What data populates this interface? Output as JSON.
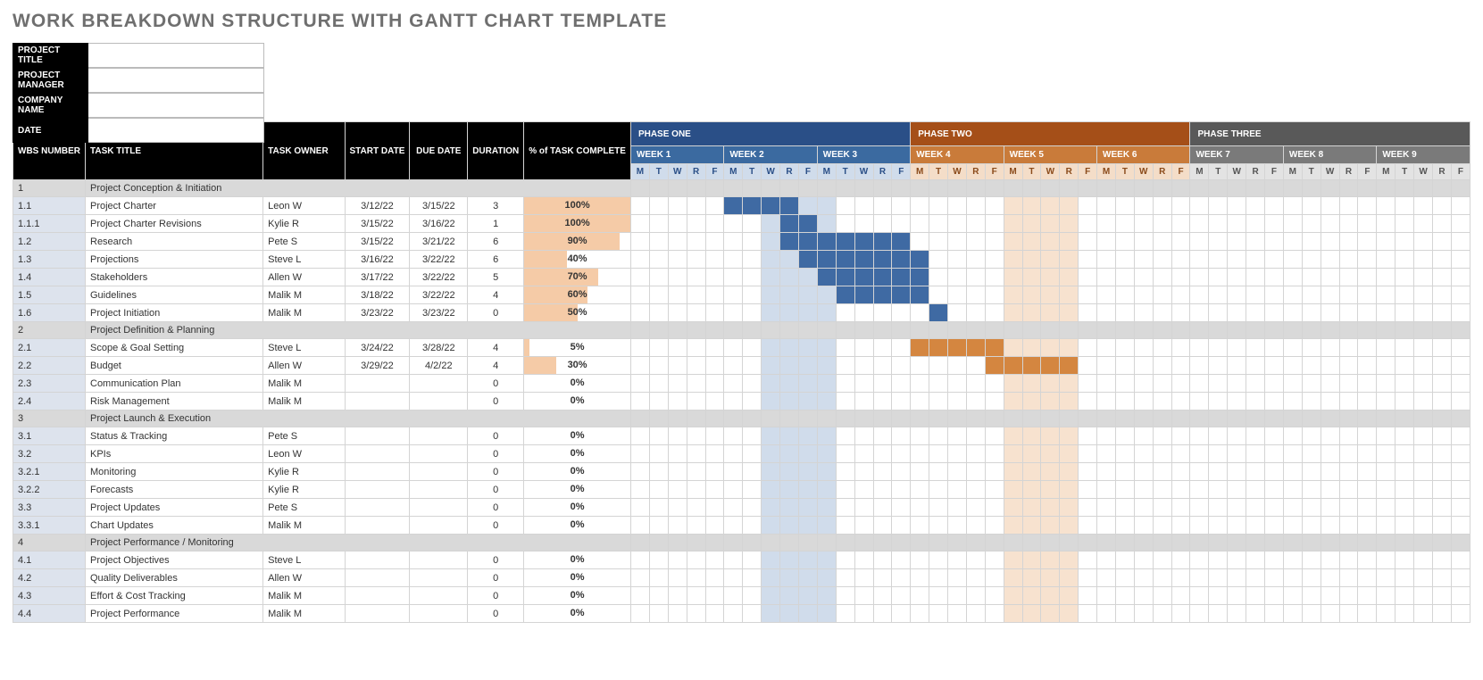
{
  "title": "WORK BREAKDOWN STRUCTURE WITH GANTT CHART TEMPLATE",
  "meta_labels": {
    "project_title": "PROJECT TITLE",
    "project_manager": "PROJECT MANAGER",
    "company_name": "COMPANY NAME",
    "date": "DATE"
  },
  "headers": {
    "wbs": "WBS NUMBER",
    "task_title": "TASK TITLE",
    "task_owner": "TASK OWNER",
    "start_date": "START DATE",
    "due_date": "DUE DATE",
    "duration": "DURATION",
    "pct": "% of TASK COMPLETE"
  },
  "phases": [
    {
      "label": "PHASE ONE",
      "weeks": 3,
      "color": "blue"
    },
    {
      "label": "PHASE TWO",
      "weeks": 3,
      "color": "orange"
    },
    {
      "label": "PHASE THREE",
      "weeks": 3,
      "color": "gray"
    }
  ],
  "week_labels": [
    "WEEK 1",
    "WEEK 2",
    "WEEK 3",
    "WEEK 4",
    "WEEK 5",
    "WEEK 6",
    "WEEK 7",
    "WEEK 8",
    "WEEK 9"
  ],
  "day_labels": [
    "M",
    "T",
    "W",
    "R",
    "F"
  ],
  "blue_light_cols": [
    7,
    8,
    9,
    10
  ],
  "orange_light_cols": [
    20,
    21,
    22,
    23
  ],
  "rows": [
    {
      "type": "section",
      "wbs": "1",
      "title": "Project Conception & Initiation"
    },
    {
      "type": "task",
      "wbs": "1.1",
      "title": "Project Charter",
      "owner": "Leon W",
      "start": "3/12/22",
      "due": "3/15/22",
      "dur": "3",
      "pct": 100,
      "bar": {
        "color": "blue",
        "start": 5,
        "len": 4
      }
    },
    {
      "type": "task",
      "wbs": "1.1.1",
      "title": "Project Charter Revisions",
      "owner": "Kylie R",
      "start": "3/15/22",
      "due": "3/16/22",
      "dur": "1",
      "pct": 100,
      "bar": {
        "color": "blue",
        "start": 8,
        "len": 2
      }
    },
    {
      "type": "task",
      "wbs": "1.2",
      "title": "Research",
      "owner": "Pete S",
      "start": "3/15/22",
      "due": "3/21/22",
      "dur": "6",
      "pct": 90,
      "bar": {
        "color": "blue",
        "start": 8,
        "len": 7
      }
    },
    {
      "type": "task",
      "wbs": "1.3",
      "title": "Projections",
      "owner": "Steve L",
      "start": "3/16/22",
      "due": "3/22/22",
      "dur": "6",
      "pct": 40,
      "bar": {
        "color": "blue",
        "start": 9,
        "len": 7
      }
    },
    {
      "type": "task",
      "wbs": "1.4",
      "title": "Stakeholders",
      "owner": "Allen W",
      "start": "3/17/22",
      "due": "3/22/22",
      "dur": "5",
      "pct": 70,
      "bar": {
        "color": "blue",
        "start": 10,
        "len": 6
      }
    },
    {
      "type": "task",
      "wbs": "1.5",
      "title": "Guidelines",
      "owner": "Malik M",
      "start": "3/18/22",
      "due": "3/22/22",
      "dur": "4",
      "pct": 60,
      "bar": {
        "color": "blue",
        "start": 11,
        "len": 5
      }
    },
    {
      "type": "task",
      "wbs": "1.6",
      "title": "Project Initiation",
      "owner": "Malik M",
      "start": "3/23/22",
      "due": "3/23/22",
      "dur": "0",
      "pct": 50,
      "bar": {
        "color": "blue",
        "start": 16,
        "len": 1
      }
    },
    {
      "type": "section",
      "wbs": "2",
      "title": "Project Definition & Planning"
    },
    {
      "type": "task",
      "wbs": "2.1",
      "title": "Scope & Goal Setting",
      "owner": "Steve L",
      "start": "3/24/22",
      "due": "3/28/22",
      "dur": "4",
      "pct": 5,
      "bar": {
        "color": "orange",
        "start": 15,
        "len": 5
      }
    },
    {
      "type": "task",
      "wbs": "2.2",
      "title": "Budget",
      "owner": "Allen W",
      "start": "3/29/22",
      "due": "4/2/22",
      "dur": "4",
      "pct": 30,
      "bar": {
        "color": "orange",
        "start": 19,
        "len": 5
      }
    },
    {
      "type": "task",
      "wbs": "2.3",
      "title": "Communication Plan",
      "owner": "Malik M",
      "start": "",
      "due": "",
      "dur": "0",
      "pct": 0
    },
    {
      "type": "task",
      "wbs": "2.4",
      "title": "Risk Management",
      "owner": "Malik M",
      "start": "",
      "due": "",
      "dur": "0",
      "pct": 0
    },
    {
      "type": "section",
      "wbs": "3",
      "title": "Project Launch & Execution"
    },
    {
      "type": "task",
      "wbs": "3.1",
      "title": "Status & Tracking",
      "owner": "Pete S",
      "start": "",
      "due": "",
      "dur": "0",
      "pct": 0
    },
    {
      "type": "task",
      "wbs": "3.2",
      "title": "KPIs",
      "owner": "Leon W",
      "start": "",
      "due": "",
      "dur": "0",
      "pct": 0
    },
    {
      "type": "task",
      "wbs": "3.2.1",
      "title": "Monitoring",
      "owner": "Kylie R",
      "start": "",
      "due": "",
      "dur": "0",
      "pct": 0
    },
    {
      "type": "task",
      "wbs": "3.2.2",
      "title": "Forecasts",
      "owner": "Kylie R",
      "start": "",
      "due": "",
      "dur": "0",
      "pct": 0
    },
    {
      "type": "task",
      "wbs": "3.3",
      "title": "Project Updates",
      "owner": "Pete S",
      "start": "",
      "due": "",
      "dur": "0",
      "pct": 0
    },
    {
      "type": "task",
      "wbs": "3.3.1",
      "title": "Chart Updates",
      "owner": "Malik M",
      "start": "",
      "due": "",
      "dur": "0",
      "pct": 0
    },
    {
      "type": "section",
      "wbs": "4",
      "title": "Project Performance / Monitoring"
    },
    {
      "type": "task",
      "wbs": "4.1",
      "title": "Project Objectives",
      "owner": "Steve L",
      "start": "",
      "due": "",
      "dur": "0",
      "pct": 0
    },
    {
      "type": "task",
      "wbs": "4.2",
      "title": "Quality Deliverables",
      "owner": "Allen W",
      "start": "",
      "due": "",
      "dur": "0",
      "pct": 0
    },
    {
      "type": "task",
      "wbs": "4.3",
      "title": "Effort & Cost Tracking",
      "owner": "Malik M",
      "start": "",
      "due": "",
      "dur": "0",
      "pct": 0
    },
    {
      "type": "task",
      "wbs": "4.4",
      "title": "Project Performance",
      "owner": "Malik M",
      "start": "",
      "due": "",
      "dur": "0",
      "pct": 0
    }
  ],
  "chart_data": {
    "type": "table",
    "title": "Work Breakdown Structure with Gantt Chart",
    "columns": [
      "WBS NUMBER",
      "TASK TITLE",
      "TASK OWNER",
      "START DATE",
      "DUE DATE",
      "DURATION",
      "% of TASK COMPLETE"
    ],
    "phases": [
      "PHASE ONE",
      "PHASE TWO",
      "PHASE THREE"
    ],
    "weeks_per_phase": 3,
    "days_per_week": [
      "M",
      "T",
      "W",
      "R",
      "F"
    ],
    "tasks": [
      {
        "wbs": "1.1",
        "title": "Project Charter",
        "owner": "Leon W",
        "start": "2022-03-12",
        "due": "2022-03-15",
        "duration": 3,
        "pct_complete": 100
      },
      {
        "wbs": "1.1.1",
        "title": "Project Charter Revisions",
        "owner": "Kylie R",
        "start": "2022-03-15",
        "due": "2022-03-16",
        "duration": 1,
        "pct_complete": 100
      },
      {
        "wbs": "1.2",
        "title": "Research",
        "owner": "Pete S",
        "start": "2022-03-15",
        "due": "2022-03-21",
        "duration": 6,
        "pct_complete": 90
      },
      {
        "wbs": "1.3",
        "title": "Projections",
        "owner": "Steve L",
        "start": "2022-03-16",
        "due": "2022-03-22",
        "duration": 6,
        "pct_complete": 40
      },
      {
        "wbs": "1.4",
        "title": "Stakeholders",
        "owner": "Allen W",
        "start": "2022-03-17",
        "due": "2022-03-22",
        "duration": 5,
        "pct_complete": 70
      },
      {
        "wbs": "1.5",
        "title": "Guidelines",
        "owner": "Malik M",
        "start": "2022-03-18",
        "due": "2022-03-22",
        "duration": 4,
        "pct_complete": 60
      },
      {
        "wbs": "1.6",
        "title": "Project Initiation",
        "owner": "Malik M",
        "start": "2022-03-23",
        "due": "2022-03-23",
        "duration": 0,
        "pct_complete": 50
      },
      {
        "wbs": "2.1",
        "title": "Scope & Goal Setting",
        "owner": "Steve L",
        "start": "2022-03-24",
        "due": "2022-03-28",
        "duration": 4,
        "pct_complete": 5
      },
      {
        "wbs": "2.2",
        "title": "Budget",
        "owner": "Allen W",
        "start": "2022-03-29",
        "due": "2022-04-02",
        "duration": 4,
        "pct_complete": 30
      },
      {
        "wbs": "2.3",
        "title": "Communication Plan",
        "owner": "Malik M",
        "duration": 0,
        "pct_complete": 0
      },
      {
        "wbs": "2.4",
        "title": "Risk Management",
        "owner": "Malik M",
        "duration": 0,
        "pct_complete": 0
      },
      {
        "wbs": "3.1",
        "title": "Status & Tracking",
        "owner": "Pete S",
        "duration": 0,
        "pct_complete": 0
      },
      {
        "wbs": "3.2",
        "title": "KPIs",
        "owner": "Leon W",
        "duration": 0,
        "pct_complete": 0
      },
      {
        "wbs": "3.2.1",
        "title": "Monitoring",
        "owner": "Kylie R",
        "duration": 0,
        "pct_complete": 0
      },
      {
        "wbs": "3.2.2",
        "title": "Forecasts",
        "owner": "Kylie R",
        "duration": 0,
        "pct_complete": 0
      },
      {
        "wbs": "3.3",
        "title": "Project Updates",
        "owner": "Pete S",
        "duration": 0,
        "pct_complete": 0
      },
      {
        "wbs": "3.3.1",
        "title": "Chart Updates",
        "owner": "Malik M",
        "duration": 0,
        "pct_complete": 0
      },
      {
        "wbs": "4.1",
        "title": "Project Objectives",
        "owner": "Steve L",
        "duration": 0,
        "pct_complete": 0
      },
      {
        "wbs": "4.2",
        "title": "Quality Deliverables",
        "owner": "Allen W",
        "duration": 0,
        "pct_complete": 0
      },
      {
        "wbs": "4.3",
        "title": "Effort & Cost Tracking",
        "owner": "Malik M",
        "duration": 0,
        "pct_complete": 0
      },
      {
        "wbs": "4.4",
        "title": "Project Performance",
        "owner": "Malik M",
        "duration": 0,
        "pct_complete": 0
      }
    ]
  }
}
